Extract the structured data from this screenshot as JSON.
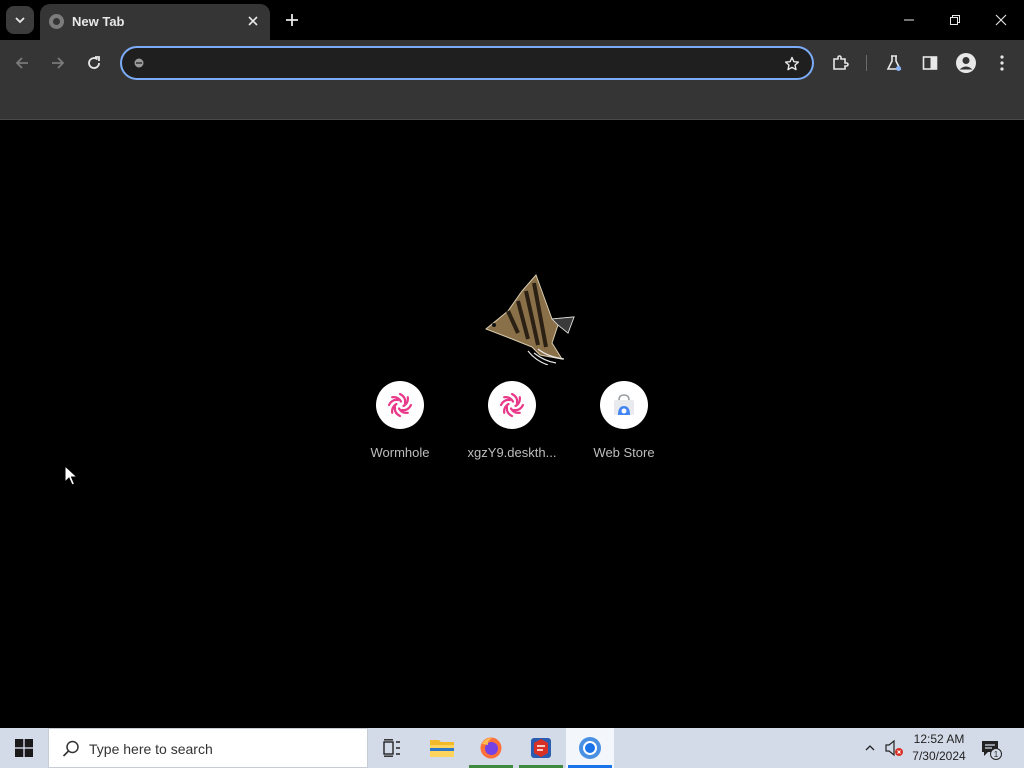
{
  "browser": {
    "tab": {
      "title": "New Tab"
    },
    "omnibox": {
      "value": "",
      "placeholder": ""
    }
  },
  "ntp": {
    "shortcuts": [
      {
        "label": "Wormhole",
        "icon": "wormhole-icon"
      },
      {
        "label": "xgzY9.deskth...",
        "icon": "wormhole-icon"
      },
      {
        "label": "Web Store",
        "icon": "web-store-icon"
      }
    ]
  },
  "taskbar": {
    "search_placeholder": "Type here to search",
    "time": "12:52 AM",
    "date": "7/30/2024",
    "notification_count": "1"
  },
  "colors": {
    "omnibox_focus": "#7cacf8",
    "wormhole_pink": "#e8388a",
    "taskbar_bg": "#d4dbe8"
  }
}
